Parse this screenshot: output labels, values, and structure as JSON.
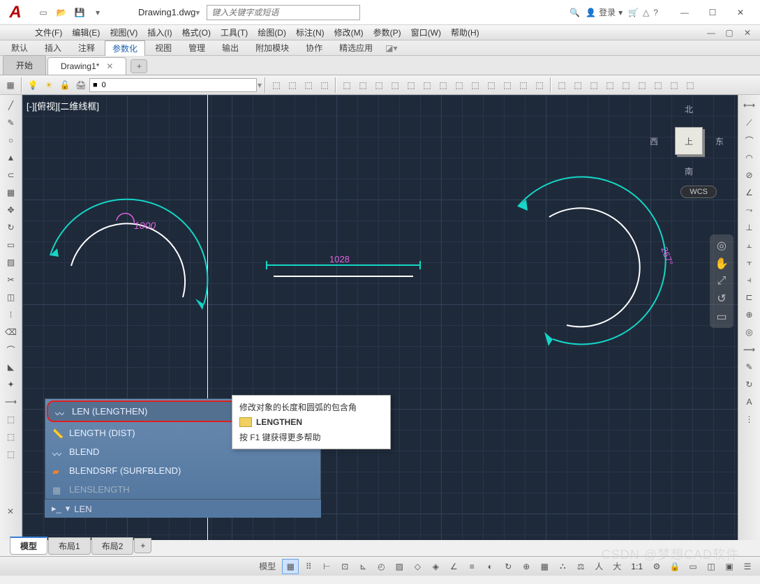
{
  "title": "Drawing1.dwg",
  "search_placeholder": "键入关键字或短语",
  "signin": "登录",
  "menu": [
    "文件(F)",
    "编辑(E)",
    "视图(V)",
    "插入(I)",
    "格式(O)",
    "工具(T)",
    "绘图(D)",
    "标注(N)",
    "修改(M)",
    "参数(P)",
    "窗口(W)",
    "帮助(H)"
  ],
  "ribbon_tabs": [
    "默认",
    "插入",
    "注释",
    "参数化",
    "视图",
    "管理",
    "输出",
    "附加模块",
    "协作",
    "精选应用"
  ],
  "ribbon_active_index": 3,
  "doc_tabs": {
    "start": "开始",
    "active": "Drawing1*"
  },
  "layer_current": "0",
  "viewport_label": "[-][俯视][二维线框]",
  "viewcube": {
    "n": "北",
    "s": "南",
    "e": "东",
    "w": "西",
    "top": "上",
    "wcs": "WCS"
  },
  "dims": {
    "arc_len": "1000",
    "line_len": "1028",
    "angle": "267°"
  },
  "suggestions": [
    {
      "label": "LEN (LENGTHEN)",
      "hl": true
    },
    {
      "label": "LENGTH (DIST)"
    },
    {
      "label": "BLEND"
    },
    {
      "label": "BLENDSRF (SURFBLEND)"
    },
    {
      "label": "LENSLENGTH",
      "dim": true
    }
  ],
  "cmd_prompt": "LEN",
  "tooltip": {
    "desc": "修改对象的长度和圆弧的包含角",
    "cmd": "LENGTHEN",
    "f1": "按 F1 键获得更多帮助"
  },
  "layout_tabs": [
    "模型",
    "布局1",
    "布局2"
  ],
  "status": {
    "space": "模型",
    "scale": "1:1"
  },
  "watermark": "CSDN @梦想CAD软件",
  "colors": {
    "canvas": "#1e2a3a",
    "dim_cyan": "#15d6c7",
    "dim_magenta": "#e060e0",
    "white": "#ffffff"
  }
}
